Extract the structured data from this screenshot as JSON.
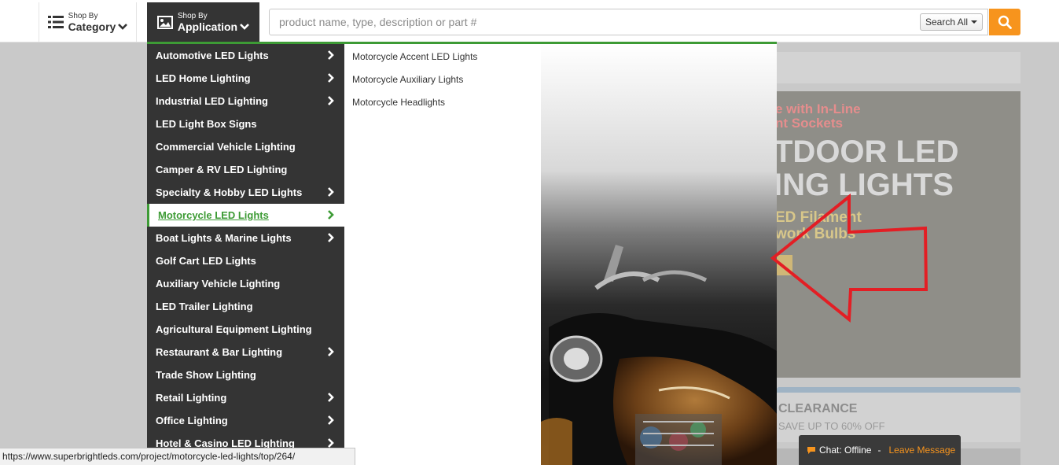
{
  "header": {
    "shop_category": {
      "small": "Shop By",
      "big": "Category"
    },
    "shop_application": {
      "small": "Shop By",
      "big": "Application"
    },
    "search": {
      "placeholder": "product name, type, description or part #",
      "scope_label": "Search All"
    }
  },
  "menu": {
    "items": [
      {
        "label": "Automotive LED Lights",
        "arrow": true
      },
      {
        "label": "LED Home Lighting",
        "arrow": true
      },
      {
        "label": "Industrial LED Lighting",
        "arrow": true
      },
      {
        "label": "LED Light Box Signs",
        "arrow": false
      },
      {
        "label": "Commercial Vehicle Lighting",
        "arrow": false
      },
      {
        "label": "Camper & RV LED Lighting",
        "arrow": false
      },
      {
        "label": "Specialty & Hobby LED Lights",
        "arrow": true
      },
      {
        "label": "Motorcycle LED Lights",
        "arrow": true,
        "active": true
      },
      {
        "label": "Boat Lights & Marine Lights",
        "arrow": true
      },
      {
        "label": "Golf Cart LED Lights",
        "arrow": false
      },
      {
        "label": "Auxiliary Vehicle Lighting",
        "arrow": false
      },
      {
        "label": "LED Trailer Lighting",
        "arrow": false
      },
      {
        "label": "Agricultural Equipment Lighting",
        "arrow": false
      },
      {
        "label": "Restaurant & Bar Lighting",
        "arrow": true
      },
      {
        "label": "Trade Show Lighting",
        "arrow": false
      },
      {
        "label": "Retail Lighting",
        "arrow": true
      },
      {
        "label": "Office Lighting",
        "arrow": true
      },
      {
        "label": "Hotel & Casino LED Lighting",
        "arrow": true
      }
    ],
    "submenu": [
      "Motorcycle Accent LED Lights",
      "Motorcycle Auxiliary Lights",
      "Motorcycle Headlights"
    ]
  },
  "banner": {
    "line1": "e with In-Line",
    "line2": "nt Sockets",
    "big1": "TDOOR LED",
    "big2": "ING LIGHTS",
    "yellow1": "ED Filament",
    "yellow2": "work Bulbs"
  },
  "clearance": {
    "title": "CLEARANCE",
    "subtitle": "SAVE UP TO 60% OFF"
  },
  "status_url": "https://www.superbrightleds.com/project/motorcycle-led-lights/top/264/",
  "chat": {
    "status": "Chat: Offline",
    "separator": "-",
    "leave": "Leave Message"
  },
  "colors": {
    "accent_green": "#3d9b35",
    "orange": "#f7941d",
    "menu_dark": "#343434",
    "arrow_red": "#e31e24"
  }
}
